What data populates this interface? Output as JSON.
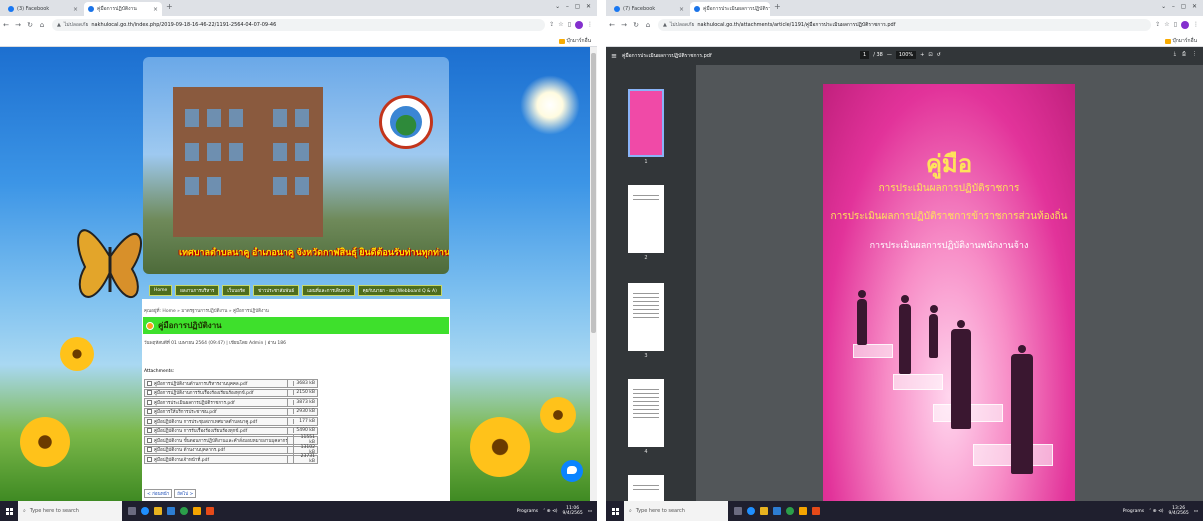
{
  "left": {
    "tabs": [
      {
        "label": "(3) Facebook"
      },
      {
        "label": "คู่มือการปฏิบัติงาน"
      }
    ],
    "address": {
      "security": "ไม่ปลอดภัย",
      "url": "nakhulocal.go.th/index.php/2019-09-18-16-46-22/1191-2564-04-07-09-46"
    },
    "bookmark_folder": "บุ๊กมาร์กอื่น",
    "website": {
      "banner": "เทศบาลตำบลนาคู อำเภอนาคู จังหวัดกาฬสินธุ์ ยินดีต้อนรับท่านทุกท่าน",
      "menu": [
        "Home",
        "ผลงานการบริหาร",
        "เว็บบอร์ด",
        "ข่าวประชาสัมพันธ์",
        "แผนที่และการเดินทาง",
        "คุยกับนายก - ผอ.(Webboard Q & A)"
      ],
      "breadcrumb": "คุณอยู่ที่: Home » มาตรฐานการปฏิบัติงาน » คู่มือการปฏิบัติงาน",
      "title": "คู่มือการปฏิบัติงาน",
      "meta": "วันพฤหัสบดีที่ 01 เมษายน 2564 (09:47) | เขียนโดย Admin | อ่าน 186",
      "attachments_label": "Attachments:",
      "attachments": [
        {
          "name": "คู่มือการปฏิบัติงานด้านการบริหารงานบุคคล.pdf",
          "size": "3683 kB"
        },
        {
          "name": "คู่มือการปฏิบัติงานการรับเรื่องร้องเรียนร้องทุกข์.pdf",
          "size": "2150 kB"
        },
        {
          "name": "คู่มือการประเมินผลการปฏิบัติราชการ.pdf",
          "size": "3873 kB"
        },
        {
          "name": "คู่มือการให้บริการประชาชน.pdf",
          "size": "2930 kB"
        },
        {
          "name": "คู่มือปฏิบัติงาน การประชุมสภาเทศบาลตำบลนาคู.pdf",
          "size": "177 kB"
        },
        {
          "name": "คู่มือปฏิบัติงาน การรับเรื่องร้องเรียนร้องทุกข์.pdf",
          "size": "5490 kB"
        },
        {
          "name": "คู่มือปฏิบัติงาน ขั้นตอนการปฏิบัติงานและคำสั่งมอบหมายงานบุคลากร.pdf",
          "size": "11551 kB"
        },
        {
          "name": "คู่มือปฏิบัติงาน ด้านงานบุคลากร.pdf",
          "size": "13102 kB"
        },
        {
          "name": "คู่มือปฏิบัติงานเจ้าหน้าที่.pdf",
          "size": "23731 kB"
        }
      ],
      "pager": [
        "< ก่อนหน้า",
        "ถัดไป >"
      ]
    },
    "taskbar": {
      "search_placeholder": "Type here to search",
      "time": "11:06",
      "date": "9/4/2565",
      "programs": "Programs"
    }
  },
  "right": {
    "tabs": [
      {
        "label": "(7) Facebook"
      },
      {
        "label": "คู่มือการประเมินผลการปฏิบัติราช..."
      }
    ],
    "address": {
      "security": "ไม่ปลอดภัย",
      "url": "nakhulocal.go.th/attachments/article/1191/คู่มือการประเมินผลการปฏิบัติราชการ.pdf"
    },
    "bookmark_folder": "บุ๊กมาร์กอื่น",
    "pdf": {
      "filename": "คู่มือการประเมินผลการปฏิบัติราชการ.pdf",
      "page_current": "1",
      "page_total": "/ 38",
      "zoom": "100%",
      "thumbnail_numbers": [
        "1",
        "2",
        "3",
        "4"
      ],
      "cover_title": "คู่มือ",
      "cover_line1": "การประเมินผลการปฏิบัติราชการ",
      "cover_line2": "การประเมินผลการปฏิบัติราชการข้าราชการส่วนท้องถิ่น",
      "cover_line3": "การประเมินผลการปฏิบัติงานพนักงานจ้าง"
    },
    "taskbar": {
      "search_placeholder": "Type here to search",
      "time": "13:26",
      "date": "9/4/2565",
      "programs": "Programs"
    }
  }
}
